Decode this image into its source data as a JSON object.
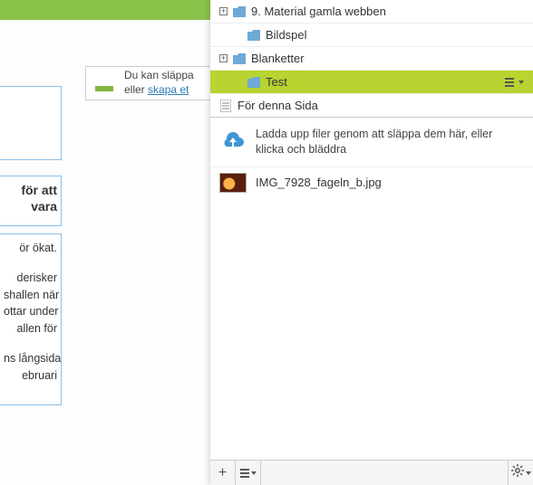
{
  "colors": {
    "topbar": "#8bc34a",
    "selected_row": "#b8d430",
    "folder": "#6fa9d6",
    "cloud": "#3e97d1",
    "download": "#7fb63f",
    "link": "#2a7ab0",
    "border_blue": "#8bbfe8"
  },
  "dropzone": {
    "line1": "Du kan släppa",
    "line2_prefix": "eller ",
    "line2_link": "skapa et"
  },
  "left_fragments": {
    "header_1": "för att",
    "header_2": "vara",
    "body_lines": [
      "ör ökat.",
      "",
      "derisker",
      "shallen när",
      "ottar under",
      "allen för",
      "",
      "ns långsida",
      "ebruari"
    ]
  },
  "tree": {
    "items": [
      {
        "expander": "+",
        "indent": 0,
        "label": "9. Material gamla webben",
        "selected": false
      },
      {
        "expander": "",
        "indent": 1,
        "label": "Bildspel",
        "selected": false
      },
      {
        "expander": "+",
        "indent": 1,
        "label": "Blanketter",
        "selected": false
      },
      {
        "expander": "",
        "indent": 2,
        "label": "Test",
        "selected": true,
        "has_menu": true
      }
    ],
    "page_item": {
      "label": "För denna Sida"
    }
  },
  "upload_hint": "Ladda upp filer genom att släppa dem här, eller klicka och bläddra",
  "file": {
    "name": "IMG_7928_fageln_b.jpg"
  },
  "bottom_bar": {
    "add": "+",
    "sort": "sort",
    "settings": "settings"
  }
}
